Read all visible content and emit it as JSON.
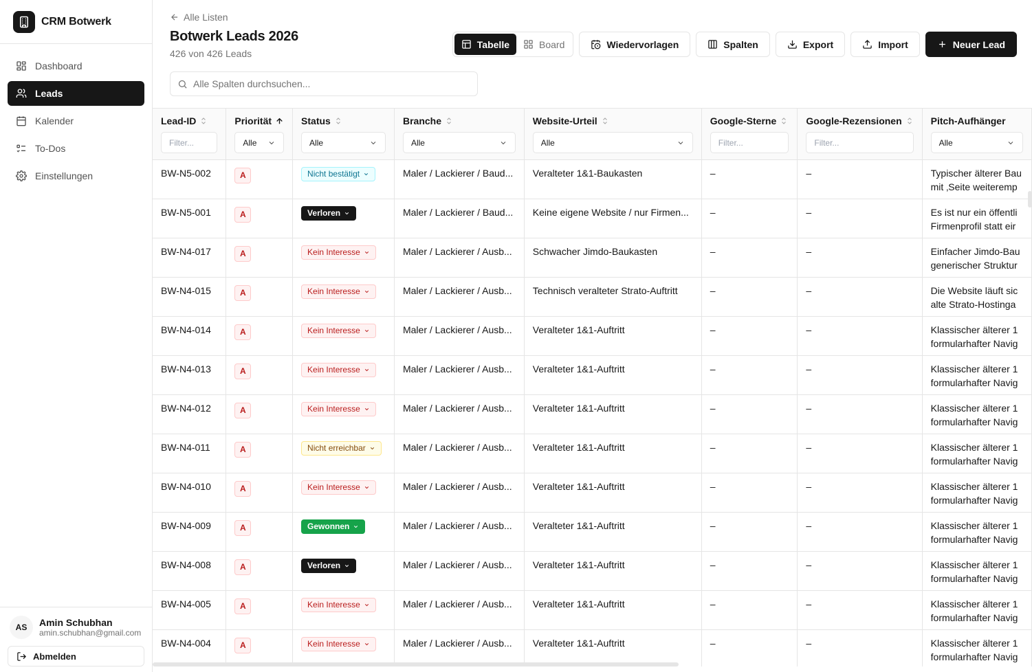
{
  "sidebar": {
    "brand": "CRM Botwerk",
    "items": [
      {
        "label": "Dashboard",
        "icon": "dashboard-icon"
      },
      {
        "label": "Leads",
        "icon": "users-icon"
      },
      {
        "label": "Kalender",
        "icon": "calendar-icon"
      },
      {
        "label": "To-Dos",
        "icon": "list-check-icon"
      },
      {
        "label": "Einstellungen",
        "icon": "gear-icon"
      }
    ],
    "user": {
      "initials": "AS",
      "name": "Amin Schubhan",
      "email": "amin.schubhan@gmail.com"
    },
    "logout_label": "Abmelden"
  },
  "header": {
    "back_label": "Alle Listen",
    "title": "Botwerk Leads 2026",
    "subtitle": "426 von 426 Leads"
  },
  "toolbar": {
    "view_table": "Tabelle",
    "view_board": "Board",
    "followups": "Wiedervorlagen",
    "columns": "Spalten",
    "export": "Export",
    "import": "Import",
    "new_lead": "Neuer Lead"
  },
  "search": {
    "placeholder": "Alle Spalten durchsuchen..."
  },
  "table": {
    "columns": [
      {
        "label": "Lead-ID",
        "filter": "Filter...",
        "filter_type": "text"
      },
      {
        "label": "Priorität",
        "filter": "Alle",
        "filter_type": "select"
      },
      {
        "label": "Status",
        "filter": "Alle",
        "filter_type": "select"
      },
      {
        "label": "Branche",
        "filter": "Alle",
        "filter_type": "select"
      },
      {
        "label": "Website-Urteil",
        "filter": "Alle",
        "filter_type": "select"
      },
      {
        "label": "Google-Sterne",
        "filter": "Filter...",
        "filter_type": "text"
      },
      {
        "label": "Google-Rezensionen",
        "filter": "Filter...",
        "filter_type": "text"
      },
      {
        "label": "Pitch-Aufhänger",
        "filter": "Alle",
        "filter_type": "select"
      }
    ],
    "rows": [
      {
        "id": "BW-N5-002",
        "prio": "A",
        "status": "Nicht bestätigt",
        "status_style": "cyan",
        "branche": "Maler / Lackierer / Baud...",
        "urteil": "Veralteter 1&1-Baukasten",
        "sterne": "–",
        "rezensionen": "–",
        "pitch1": "Typischer älterer Bau",
        "pitch2": "mit ‚Seite weiteremp"
      },
      {
        "id": "BW-N5-001",
        "prio": "A",
        "status": "Verloren",
        "status_style": "black",
        "branche": "Maler / Lackierer / Baud...",
        "urteil": "Keine eigene Website / nur Firmen...",
        "sterne": "–",
        "rezensionen": "–",
        "pitch1": "Es ist nur ein öffentli",
        "pitch2": "Firmenprofil statt eir"
      },
      {
        "id": "BW-N4-017",
        "prio": "A",
        "status": "Kein Interesse",
        "status_style": "red",
        "branche": "Maler / Lackierer / Ausb...",
        "urteil": "Schwacher Jimdo-Baukasten",
        "sterne": "–",
        "rezensionen": "–",
        "pitch1": "Einfacher Jimdo-Bau",
        "pitch2": "generischer Struktur"
      },
      {
        "id": "BW-N4-015",
        "prio": "A",
        "status": "Kein Interesse",
        "status_style": "red",
        "branche": "Maler / Lackierer / Ausb...",
        "urteil": "Technisch veralteter Strato-Auftritt",
        "sterne": "–",
        "rezensionen": "–",
        "pitch1": "Die Website läuft sic",
        "pitch2": "alte Strato-Hostinga"
      },
      {
        "id": "BW-N4-014",
        "prio": "A",
        "status": "Kein Interesse",
        "status_style": "red",
        "branche": "Maler / Lackierer / Ausb...",
        "urteil": "Veralteter 1&1-Auftritt",
        "sterne": "–",
        "rezensionen": "–",
        "pitch1": "Klassischer älterer 1",
        "pitch2": "formularhafter Navig"
      },
      {
        "id": "BW-N4-013",
        "prio": "A",
        "status": "Kein Interesse",
        "status_style": "red",
        "branche": "Maler / Lackierer / Ausb...",
        "urteil": "Veralteter 1&1-Auftritt",
        "sterne": "–",
        "rezensionen": "–",
        "pitch1": "Klassischer älterer 1",
        "pitch2": "formularhafter Navig"
      },
      {
        "id": "BW-N4-012",
        "prio": "A",
        "status": "Kein Interesse",
        "status_style": "red",
        "branche": "Maler / Lackierer / Ausb...",
        "urteil": "Veralteter 1&1-Auftritt",
        "sterne": "–",
        "rezensionen": "–",
        "pitch1": "Klassischer älterer 1",
        "pitch2": "formularhafter Navig"
      },
      {
        "id": "BW-N4-011",
        "prio": "A",
        "status": "Nicht erreichbar",
        "status_style": "yellow",
        "branche": "Maler / Lackierer / Ausb...",
        "urteil": "Veralteter 1&1-Auftritt",
        "sterne": "–",
        "rezensionen": "–",
        "pitch1": "Klassischer älterer 1",
        "pitch2": "formularhafter Navig"
      },
      {
        "id": "BW-N4-010",
        "prio": "A",
        "status": "Kein Interesse",
        "status_style": "red",
        "branche": "Maler / Lackierer / Ausb...",
        "urteil": "Veralteter 1&1-Auftritt",
        "sterne": "–",
        "rezensionen": "–",
        "pitch1": "Klassischer älterer 1",
        "pitch2": "formularhafter Navig"
      },
      {
        "id": "BW-N4-009",
        "prio": "A",
        "status": "Gewonnen",
        "status_style": "green",
        "branche": "Maler / Lackierer / Ausb...",
        "urteil": "Veralteter 1&1-Auftritt",
        "sterne": "–",
        "rezensionen": "–",
        "pitch1": "Klassischer älterer 1",
        "pitch2": "formularhafter Navig"
      },
      {
        "id": "BW-N4-008",
        "prio": "A",
        "status": "Verloren",
        "status_style": "black",
        "branche": "Maler / Lackierer / Ausb...",
        "urteil": "Veralteter 1&1-Auftritt",
        "sterne": "–",
        "rezensionen": "–",
        "pitch1": "Klassischer älterer 1",
        "pitch2": "formularhafter Navig"
      },
      {
        "id": "BW-N4-005",
        "prio": "A",
        "status": "Kein Interesse",
        "status_style": "red",
        "branche": "Maler / Lackierer / Ausb...",
        "urteil": "Veralteter 1&1-Auftritt",
        "sterne": "–",
        "rezensionen": "–",
        "pitch1": "Klassischer älterer 1",
        "pitch2": "formularhafter Navig"
      },
      {
        "id": "BW-N4-004",
        "prio": "A",
        "status": "Kein Interesse",
        "status_style": "red",
        "branche": "Maler / Lackierer / Ausb...",
        "urteil": "Veralteter 1&1-Auftritt",
        "sterne": "–",
        "rezensionen": "–",
        "pitch1": "Klassischer älterer 1",
        "pitch2": "formularhafter Navig"
      }
    ]
  }
}
